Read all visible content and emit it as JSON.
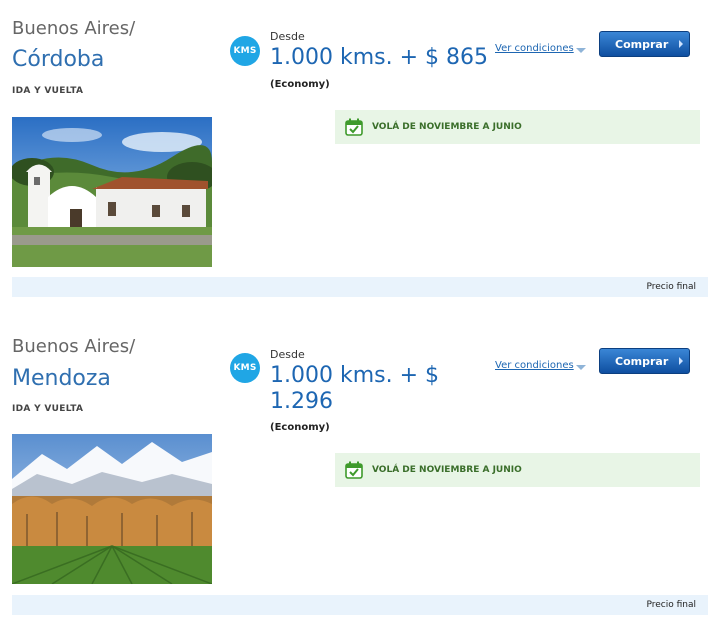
{
  "offers": [
    {
      "origin": "Buenos Aires/",
      "destination": "Córdoba",
      "trip_type": "IDA Y VUELTA",
      "badge": "KMS",
      "from_label": "Desde",
      "price": "1.000 kms. + $ 865",
      "cabin": "(Economy)",
      "conditions_link": "Ver condiciones",
      "buy_button": "Comprar",
      "promo": "VOLÁ DE NOVIEMBRE A JUNIO",
      "footer": "Precio final",
      "photo_icon": "white-colonial-church-photo"
    },
    {
      "origin": "Buenos Aires/",
      "destination": "Mendoza",
      "trip_type": "IDA Y VUELTA",
      "badge": "KMS",
      "from_label": "Desde",
      "price_line1": "1.000 kms. + $",
      "price_line2": "1.296",
      "cabin": "(Economy)",
      "conditions_link": "Ver condiciones",
      "buy_button": "Comprar",
      "promo": "VOLÁ DE NOVIEMBRE A JUNIO",
      "footer": "Precio final",
      "photo_icon": "snowy-andes-vineyard-photo"
    }
  ],
  "colors": {
    "accent": "#1d66b2",
    "badge": "#20a6e5",
    "promo_bg": "#e8f5e6",
    "footer_bg": "#e9f3fc"
  }
}
